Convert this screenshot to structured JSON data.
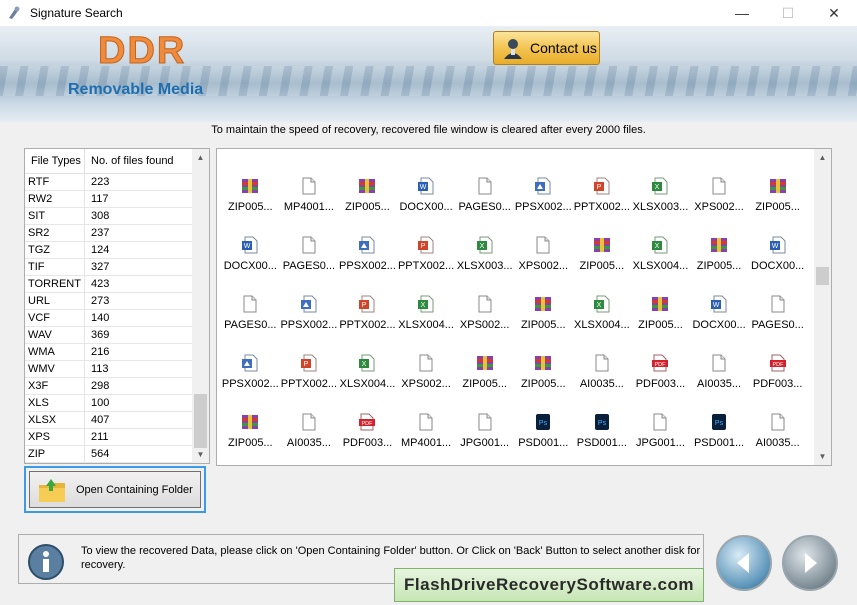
{
  "window": {
    "title": "Signature Search",
    "minimize": "—",
    "maximize": "☐",
    "close": "✕"
  },
  "header": {
    "logo": "DDR",
    "product": "Removable Media",
    "contact_label": "Contact us"
  },
  "info_line": "To maintain the speed of recovery, recovered file window is cleared after every 2000 files.",
  "file_types_table": {
    "headers": [
      "File Types",
      "No. of files found"
    ],
    "rows": [
      [
        "RTF",
        "223"
      ],
      [
        "RW2",
        "117"
      ],
      [
        "SIT",
        "308"
      ],
      [
        "SR2",
        "237"
      ],
      [
        "TGZ",
        "124"
      ],
      [
        "TIF",
        "327"
      ],
      [
        "TORRENT",
        "423"
      ],
      [
        "URL",
        "273"
      ],
      [
        "VCF",
        "140"
      ],
      [
        "WAV",
        "369"
      ],
      [
        "WMA",
        "216"
      ],
      [
        "WMV",
        "113"
      ],
      [
        "X3F",
        "298"
      ],
      [
        "XLS",
        "100"
      ],
      [
        "XLSX",
        "407"
      ],
      [
        "XPS",
        "211"
      ],
      [
        "ZIP",
        "564"
      ]
    ]
  },
  "open_folder_label": "Open Containing Folder",
  "files": [
    {
      "label": "ZIP005...",
      "icon": "zip"
    },
    {
      "label": "MP4001...",
      "icon": "blank"
    },
    {
      "label": "ZIP005...",
      "icon": "zip"
    },
    {
      "label": "DOCX00...",
      "icon": "docx"
    },
    {
      "label": "PAGES0...",
      "icon": "blank"
    },
    {
      "label": "PPSX002...",
      "icon": "ppsx"
    },
    {
      "label": "PPTX002...",
      "icon": "pptx"
    },
    {
      "label": "XLSX003...",
      "icon": "xlsx"
    },
    {
      "label": "XPS002...",
      "icon": "blank"
    },
    {
      "label": "ZIP005...",
      "icon": "zip"
    },
    {
      "label": "DOCX00...",
      "icon": "docx"
    },
    {
      "label": "PAGES0...",
      "icon": "blank"
    },
    {
      "label": "PPSX002...",
      "icon": "ppsx"
    },
    {
      "label": "PPTX002...",
      "icon": "pptx"
    },
    {
      "label": "XLSX003...",
      "icon": "xlsx"
    },
    {
      "label": "XPS002...",
      "icon": "blank"
    },
    {
      "label": "ZIP005...",
      "icon": "zip"
    },
    {
      "label": "XLSX004...",
      "icon": "xlsx"
    },
    {
      "label": "ZIP005...",
      "icon": "zip"
    },
    {
      "label": "DOCX00...",
      "icon": "docx"
    },
    {
      "label": "PAGES0...",
      "icon": "blank"
    },
    {
      "label": "PPSX002...",
      "icon": "ppsx"
    },
    {
      "label": "PPTX002...",
      "icon": "pptx"
    },
    {
      "label": "XLSX004...",
      "icon": "xlsx"
    },
    {
      "label": "XPS002...",
      "icon": "blank"
    },
    {
      "label": "ZIP005...",
      "icon": "zip"
    },
    {
      "label": "XLSX004...",
      "icon": "xlsx"
    },
    {
      "label": "ZIP005...",
      "icon": "zip"
    },
    {
      "label": "DOCX00...",
      "icon": "docx"
    },
    {
      "label": "PAGES0...",
      "icon": "blank"
    },
    {
      "label": "PPSX002...",
      "icon": "ppsx"
    },
    {
      "label": "PPTX002...",
      "icon": "pptx"
    },
    {
      "label": "XLSX004...",
      "icon": "xlsx"
    },
    {
      "label": "XPS002...",
      "icon": "blank"
    },
    {
      "label": "ZIP005...",
      "icon": "zip"
    },
    {
      "label": "ZIP005...",
      "icon": "zip"
    },
    {
      "label": "AI0035...",
      "icon": "blank"
    },
    {
      "label": "PDF003...",
      "icon": "pdf"
    },
    {
      "label": "AI0035...",
      "icon": "blank"
    },
    {
      "label": "PDF003...",
      "icon": "pdf"
    },
    {
      "label": "ZIP005...",
      "icon": "zip"
    },
    {
      "label": "AI0035...",
      "icon": "blank"
    },
    {
      "label": "PDF003...",
      "icon": "pdf"
    },
    {
      "label": "MP4001...",
      "icon": "blank"
    },
    {
      "label": "JPG001...",
      "icon": "blank"
    },
    {
      "label": "PSD001...",
      "icon": "psd"
    },
    {
      "label": "PSD001...",
      "icon": "psd"
    },
    {
      "label": "JPG001...",
      "icon": "blank"
    },
    {
      "label": "PSD001...",
      "icon": "psd"
    },
    {
      "label": "AI0035...",
      "icon": "blank"
    }
  ],
  "bottom_info": "To view the recovered Data, please click on 'Open Containing Folder' button. Or Click on 'Back' Button to select another disk for recovery.",
  "brand": "FlashDriveRecoverySoftware.com",
  "colors": {
    "accent_blue": "#3c9be8",
    "logo_orange": "#f08a3c",
    "product_blue": "#1f6fb0"
  }
}
